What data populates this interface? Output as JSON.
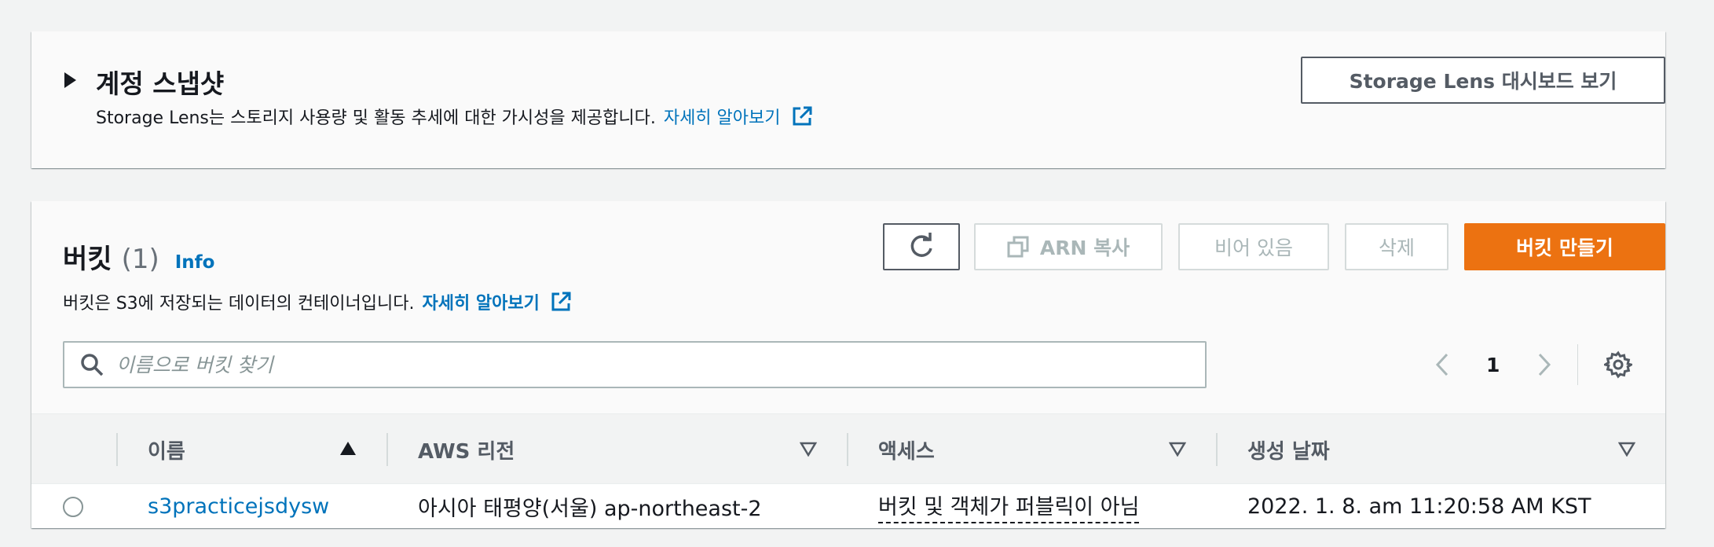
{
  "snapshot": {
    "title": "계정 스냅샷",
    "description": "Storage Lens는 스토리지 사용량 및 활동 추세에 대한 가시성을 제공합니다.",
    "learn_more": "자세히 알아보기",
    "dashboard_button": "Storage Lens 대시보드 보기"
  },
  "buckets": {
    "title": "버킷",
    "count": "(1)",
    "info": "Info",
    "description": "버킷은 S3에 저장되는 데이터의 컨테이너입니다.",
    "learn_more": "자세히 알아보기",
    "buttons": {
      "copy_arn": "ARN 복사",
      "empty": "비어 있음",
      "delete": "삭제",
      "create": "버킷 만들기"
    },
    "search": {
      "placeholder": "이름으로 버킷 찾기",
      "value": ""
    },
    "pagination": {
      "current_page": "1"
    },
    "table": {
      "columns": [
        {
          "label": "이름",
          "sort": "ascending"
        },
        {
          "label": "AWS 리전",
          "sort": "none"
        },
        {
          "label": "액세스",
          "sort": "none"
        },
        {
          "label": "생성 날짜",
          "sort": "none"
        }
      ],
      "rows": [
        {
          "name": "s3practicejsdysw",
          "region": "아시아 태평양(서울) ap-northeast-2",
          "access": "버킷 및 객체가 퍼블릭이 아님",
          "created": "2022. 1. 8. am 11:20:58 AM KST"
        }
      ]
    }
  },
  "colors": {
    "link": "#0073bb",
    "primary_button": "#ec7211",
    "disabled_text": "#aab7b8",
    "background": "#f2f3f3"
  },
  "icons": [
    "caret-right-icon",
    "external-link-icon",
    "refresh-icon",
    "copy-icon",
    "search-icon",
    "chevron-left-icon",
    "chevron-right-icon",
    "gear-icon",
    "sort-ascending-icon",
    "sort-descending-outline-icon"
  ]
}
